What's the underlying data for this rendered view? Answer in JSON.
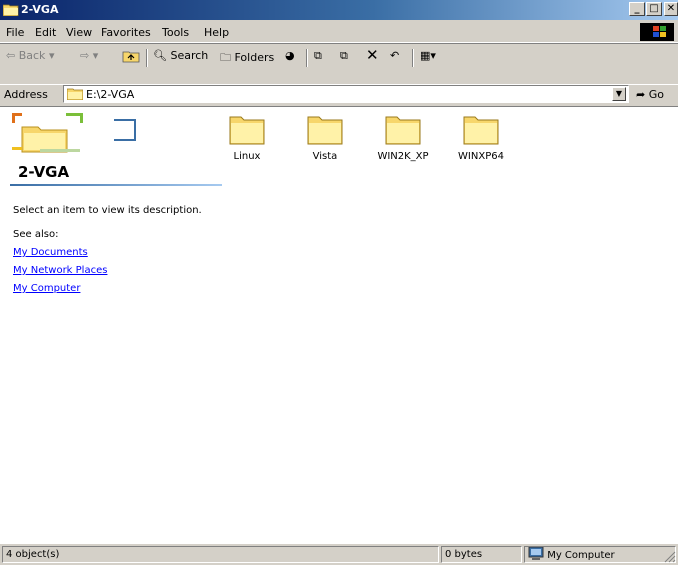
{
  "window": {
    "title": "2-VGA"
  },
  "menu": {
    "items": [
      {
        "label": "File"
      },
      {
        "label": "Edit"
      },
      {
        "label": "View"
      },
      {
        "label": "Favorites"
      },
      {
        "label": "Tools"
      },
      {
        "label": "Help"
      }
    ]
  },
  "toolbar": {
    "back": "Back",
    "search": "Search",
    "folders": "Folders"
  },
  "address": {
    "label": "Address",
    "value": "E:\\2-VGA",
    "go": "Go"
  },
  "panel": {
    "folder_name": "2-VGA",
    "description": "Select an item to view its description.",
    "see_also": "See also:",
    "links": [
      "My Documents",
      "My Network Places",
      "My Computer"
    ]
  },
  "files": [
    {
      "name": "Linux",
      "icon": "folder-icon"
    },
    {
      "name": "Vista",
      "icon": "folder-icon"
    },
    {
      "name": "WIN2K_XP",
      "icon": "folder-icon"
    },
    {
      "name": "WINXP64",
      "icon": "folder-icon"
    }
  ],
  "status": {
    "objects": "4 object(s)",
    "size": "0 bytes",
    "zone": "My Computer"
  },
  "colors": {
    "title_active": "#0a246a",
    "title_gradient_end": "#a6caf0",
    "face": "#d4d0c8",
    "link": "#0000ff",
    "folder": "#fff2a8"
  }
}
